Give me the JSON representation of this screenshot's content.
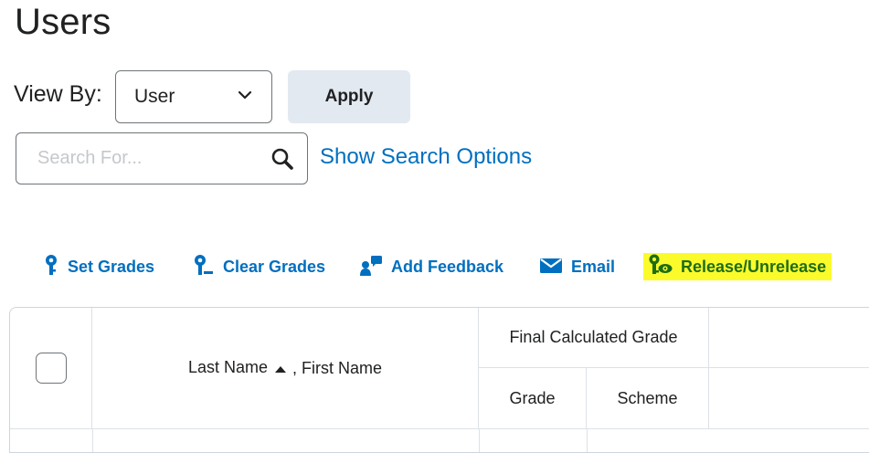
{
  "page": {
    "title": "Users"
  },
  "view_by": {
    "label": "View By:",
    "selected": "User",
    "apply_label": "Apply"
  },
  "search": {
    "placeholder": "Search For...",
    "value": "",
    "show_options_label": "Show Search Options"
  },
  "toolbar": {
    "items": [
      {
        "label": "Set Grades",
        "icon": "set-grades-icon"
      },
      {
        "label": "Clear Grades",
        "icon": "clear-grades-icon"
      },
      {
        "label": "Add Feedback",
        "icon": "add-feedback-icon"
      },
      {
        "label": "Email",
        "icon": "email-icon"
      },
      {
        "label": "Release/Unrelease",
        "icon": "release-unrelease-icon",
        "highlighted": true
      }
    ]
  },
  "grid": {
    "name_header": {
      "last": "Last Name",
      "sep": ", ",
      "first": "First Name"
    },
    "final_grade_header": "Final Calculated Grade",
    "sub_headers": [
      "Grade",
      "Scheme"
    ]
  },
  "colors": {
    "link": "#006fbf",
    "highlight": "#fbfb2c",
    "highlight_text": "#1e6d14",
    "apply_bg": "#e3e9f1"
  }
}
